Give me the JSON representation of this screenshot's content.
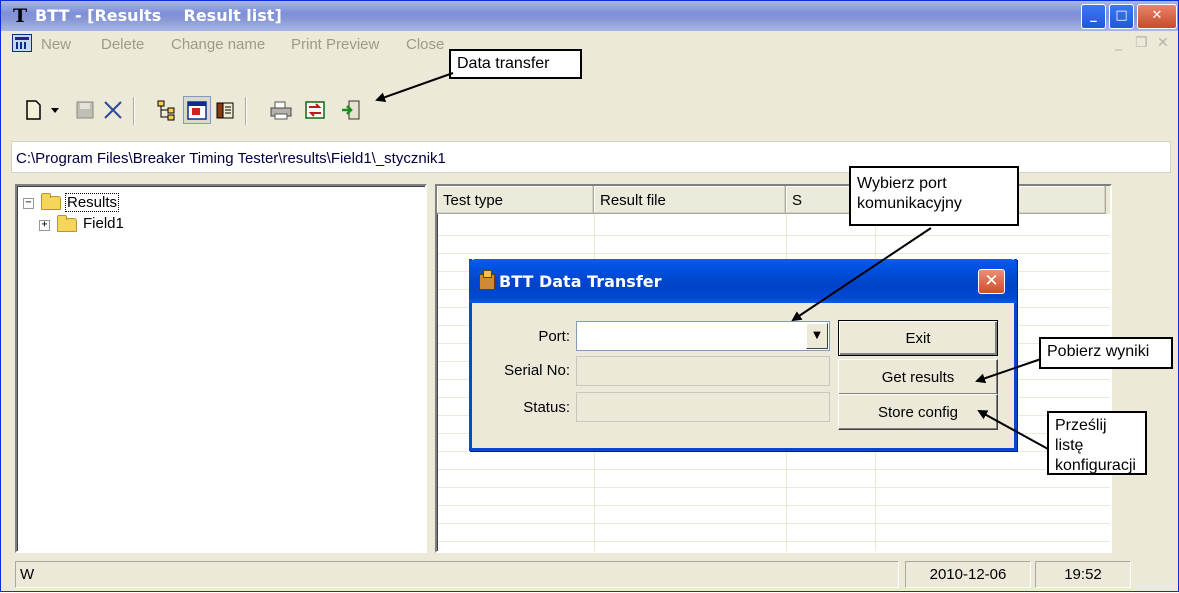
{
  "window": {
    "app_name": "BTT",
    "title": "BTT - [Results    Result list]"
  },
  "menu": {
    "items": [
      "New",
      "Delete",
      "Change name",
      "Print Preview",
      "Close"
    ]
  },
  "path": "C:\\Program Files\\Breaker Timing Tester\\results\\Field1\\_stycznik1",
  "tree": {
    "root": "Results",
    "child": "Field1"
  },
  "list": {
    "columns": [
      "Test type",
      "Result file",
      "S"
    ]
  },
  "status": {
    "text": "W",
    "date": "2010-12-06",
    "time": "19:52"
  },
  "dialog": {
    "title": "BTT Data Transfer",
    "port_label": "Port:",
    "port_value": "",
    "serial_label": "Serial No:",
    "serial_value": "",
    "status_label": "Status:",
    "status_value": "",
    "exit_label": "Exit",
    "get_results_label": "Get results",
    "store_config_label": "Store config"
  },
  "callouts": {
    "data_transfer": "Data transfer",
    "select_port": "Wybierz port komunikacyjny",
    "get_results": "Pobierz wyniki",
    "send_config": "Prześlij listę konfiguracji"
  },
  "colors": {
    "titlebar_inactive": "#8797d6",
    "dialog_title": "#0042c8",
    "window_face": "#ece9d8",
    "close_button": "#d04d2b"
  }
}
